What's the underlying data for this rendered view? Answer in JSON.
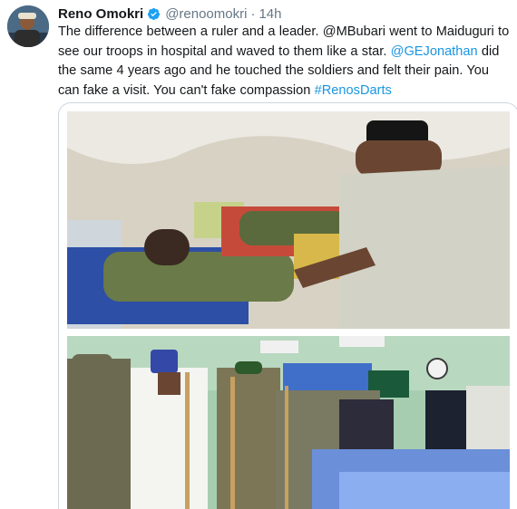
{
  "tweet": {
    "author_name": "Reno Omokri",
    "handle": "@renoomokri",
    "separator": "·",
    "timestamp": "14h",
    "text_parts": [
      "The difference between a ruler and a leader. @MBubari went to Maiduguri to see our troops in hospital and waved to them like a star. ",
      "@GEJonathan",
      " did the same 4 years ago and he touched the soldiers and felt their pain. You can fake a visit. You can't fake compassion ",
      "#RenosDarts"
    ]
  },
  "icons": {
    "verified": "verified-badge-icon"
  },
  "colors": {
    "link": "#1b95e0",
    "secondary_text": "#657786",
    "verified_blue": "#1da1f2"
  }
}
